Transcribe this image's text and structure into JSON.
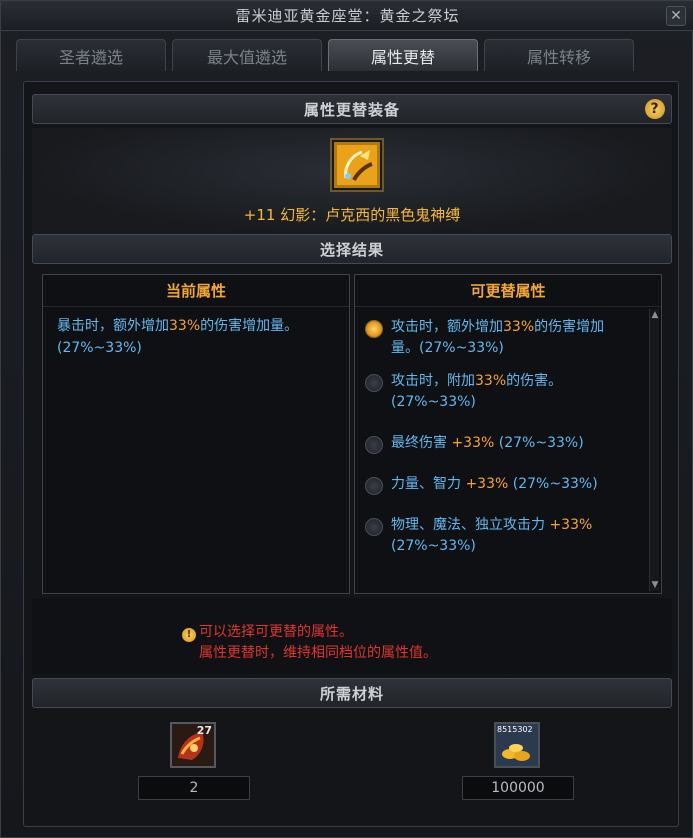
{
  "window": {
    "title": "雷米迪亚黄金座堂：黄金之祭坛",
    "close_label": "✕"
  },
  "tabs": [
    {
      "label": "圣者遴选",
      "active": false
    },
    {
      "label": "最大值遴选",
      "active": false
    },
    {
      "label": "属性更替",
      "active": true
    },
    {
      "label": "属性转移",
      "active": false
    }
  ],
  "equip_section": {
    "title": "属性更替装备",
    "help": "?",
    "item_name": "+11 幻影：卢克西的黑色鬼神缚",
    "item_icon": "dark-bracelet-icon"
  },
  "result_section": {
    "title": "选择结果"
  },
  "current": {
    "heading": "当前属性",
    "text_pre": "暴击时，额外增加",
    "text_hl": "33%",
    "text_post": "的伤害增加量。(27%~33%)"
  },
  "replaceable": {
    "heading": "可更替属性",
    "options": [
      {
        "pre": "攻击时，额外增加",
        "hl": "33%",
        "post": "的伤害增加量。(27%~33%)",
        "selected": true
      },
      {
        "pre": "攻击时，附加",
        "hl": "33%",
        "post": "的伤害。(27%~33%)",
        "selected": false
      },
      {
        "pre": "最终伤害 ",
        "hl": "+33%",
        "post": " (27%~33%)",
        "selected": false
      },
      {
        "pre": "力量、智力 ",
        "hl": "+33%",
        "post": " (27%~33%)",
        "selected": false
      },
      {
        "pre": "物理、魔法、独立攻击力 ",
        "hl": "+33%",
        "post": " (27%~33%)",
        "selected": false
      }
    ]
  },
  "notice": {
    "line1": "可以选择可更替的属性。",
    "line2": "属性更替时，维持相同档位的属性值。",
    "icon": "warning-icon"
  },
  "materials": {
    "title": "所需材料",
    "items": [
      {
        "icon": "material-stone-icon",
        "badge": "27",
        "count": "2"
      },
      {
        "icon": "gold-coins-icon",
        "badge": "8515302",
        "count": "100000"
      }
    ]
  },
  "colors": {
    "accent_orange": "#f6a33a",
    "text_blue": "#65b8ef",
    "warning_red": "#e0352e",
    "item_gold": "#f6b83a"
  }
}
